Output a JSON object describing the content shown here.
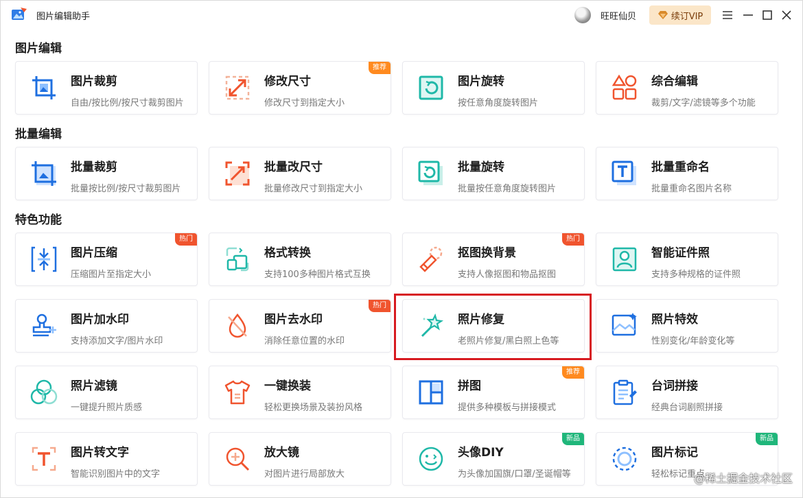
{
  "app": {
    "title": "图片编辑助手",
    "user_name": "旺旺仙贝",
    "vip_label": "续订VIP"
  },
  "colors": {
    "accent_blue": "#1e6fe0",
    "accent_orange": "#f0542e",
    "accent_teal": "#1fb8a8",
    "badge_orange": "#ff8a1f",
    "badge_red": "#f0542e",
    "badge_green": "#1fb67a"
  },
  "sections": [
    {
      "title": "图片编辑"
    },
    {
      "title": "批量编辑"
    },
    {
      "title": "特色功能"
    }
  ],
  "cards": [
    {
      "title": "图片裁剪",
      "desc": "自由/按比例/按尺寸裁剪图片",
      "icon": "crop-image-icon"
    },
    {
      "title": "修改尺寸",
      "desc": "修改尺寸到指定大小",
      "icon": "resize-icon",
      "badge": "推荐"
    },
    {
      "title": "图片旋转",
      "desc": "按任意角度旋转图片",
      "icon": "rotate-icon"
    },
    {
      "title": "综合编辑",
      "desc": "裁剪/文字/滤镜等多个功能",
      "icon": "shapes-icon"
    },
    {
      "title": "批量裁剪",
      "desc": "批量按比例/按尺寸裁剪图片",
      "icon": "batch-crop-icon"
    },
    {
      "title": "批量改尺寸",
      "desc": "批量修改尺寸到指定大小",
      "icon": "batch-resize-icon"
    },
    {
      "title": "批量旋转",
      "desc": "批量按任意角度旋转图片",
      "icon": "batch-rotate-icon"
    },
    {
      "title": "批量重命名",
      "desc": "批量重命名图片名称",
      "icon": "rename-icon"
    },
    {
      "title": "图片压缩",
      "desc": "压缩图片至指定大小",
      "icon": "compress-icon",
      "badge": "热门"
    },
    {
      "title": "格式转换",
      "desc": "支持100多种图片格式互换",
      "icon": "format-convert-icon"
    },
    {
      "title": "抠图换背景",
      "desc": "支持人像抠图和物品抠图",
      "icon": "cutout-icon",
      "badge": "热门"
    },
    {
      "title": "智能证件照",
      "desc": "支持多种规格的证件照",
      "icon": "id-photo-icon"
    },
    {
      "title": "图片加水印",
      "desc": "支持添加文字/图片水印",
      "icon": "add-watermark-icon"
    },
    {
      "title": "图片去水印",
      "desc": "消除任意位置的水印",
      "icon": "remove-watermark-icon",
      "badge": "热门"
    },
    {
      "title": "照片修复",
      "desc": "老照片修复/黑白照上色等",
      "icon": "magic-wand-icon"
    },
    {
      "title": "照片特效",
      "desc": "性别变化/年龄变化等",
      "icon": "photo-effect-icon"
    },
    {
      "title": "照片滤镜",
      "desc": "一键提升照片质感",
      "icon": "filter-icon"
    },
    {
      "title": "一键换装",
      "desc": "轻松更换场景及装扮风格",
      "icon": "shirt-icon"
    },
    {
      "title": "拼图",
      "desc": "提供多种模板与拼接模式",
      "icon": "collage-icon",
      "badge": "推荐"
    },
    {
      "title": "台词拼接",
      "desc": "经典台词剧照拼接",
      "icon": "clipboard-icon"
    },
    {
      "title": "图片转文字",
      "desc": "智能识别图片中的文字",
      "icon": "ocr-icon"
    },
    {
      "title": "放大镜",
      "desc": "对图片进行局部放大",
      "icon": "magnifier-icon"
    },
    {
      "title": "头像DIY",
      "desc": "为头像加国旗/口罩/圣诞帽等",
      "icon": "smiley-icon",
      "badge": "新品"
    },
    {
      "title": "图片标记",
      "desc": "轻松标记重点",
      "icon": "mark-icon",
      "badge": "新品"
    }
  ],
  "watermark": "@稀土掘金技术社区"
}
